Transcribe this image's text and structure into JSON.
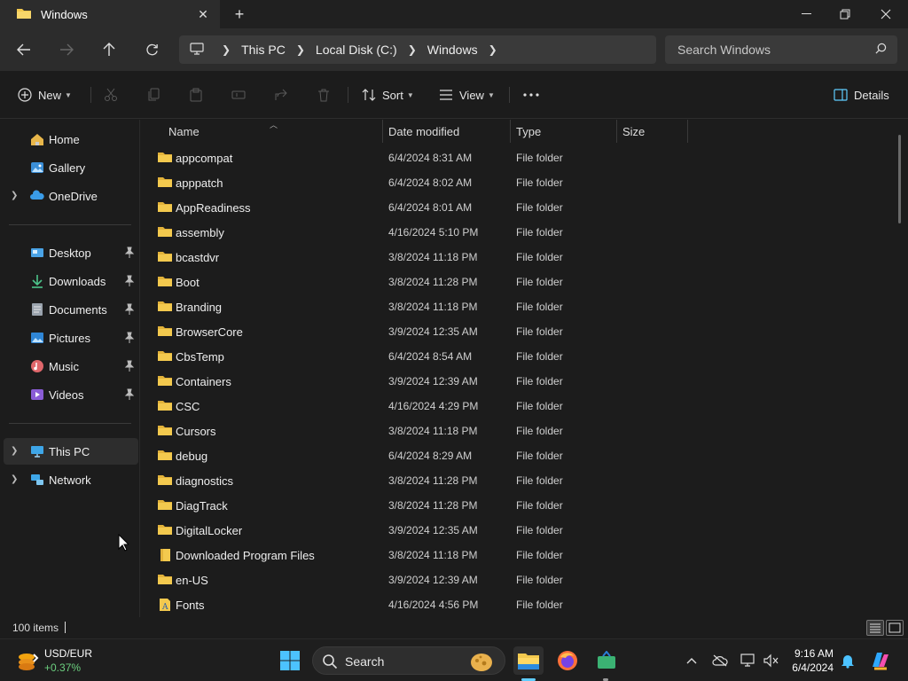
{
  "tab": {
    "title": "Windows"
  },
  "breadcrumb": [
    "This PC",
    "Local Disk (C:)",
    "Windows"
  ],
  "search": {
    "placeholder": "Search Windows"
  },
  "toolbar": {
    "new_label": "New",
    "sort_label": "Sort",
    "view_label": "View",
    "details_label": "Details"
  },
  "sidebar": {
    "top": [
      {
        "label": "Home",
        "icon": "home-icon"
      },
      {
        "label": "Gallery",
        "icon": "gallery-icon"
      },
      {
        "label": "OneDrive",
        "icon": "onedrive-icon"
      }
    ],
    "quick": [
      {
        "label": "Desktop",
        "icon": "desktop-icon"
      },
      {
        "label": "Downloads",
        "icon": "downloads-icon"
      },
      {
        "label": "Documents",
        "icon": "documents-icon"
      },
      {
        "label": "Pictures",
        "icon": "pictures-icon"
      },
      {
        "label": "Music",
        "icon": "music-icon"
      },
      {
        "label": "Videos",
        "icon": "videos-icon"
      }
    ],
    "bottom": [
      {
        "label": "This PC",
        "icon": "this-pc-icon"
      },
      {
        "label": "Network",
        "icon": "network-icon"
      }
    ]
  },
  "columns": {
    "name": "Name",
    "date": "Date modified",
    "type": "Type",
    "size": "Size"
  },
  "files": [
    {
      "name": "appcompat",
      "date": "6/4/2024 8:31 AM",
      "type": "File folder"
    },
    {
      "name": "apppatch",
      "date": "6/4/2024 8:02 AM",
      "type": "File folder"
    },
    {
      "name": "AppReadiness",
      "date": "6/4/2024 8:01 AM",
      "type": "File folder"
    },
    {
      "name": "assembly",
      "date": "4/16/2024 5:10 PM",
      "type": "File folder"
    },
    {
      "name": "bcastdvr",
      "date": "3/8/2024 11:18 PM",
      "type": "File folder"
    },
    {
      "name": "Boot",
      "date": "3/8/2024 11:28 PM",
      "type": "File folder"
    },
    {
      "name": "Branding",
      "date": "3/8/2024 11:18 PM",
      "type": "File folder"
    },
    {
      "name": "BrowserCore",
      "date": "3/9/2024 12:35 AM",
      "type": "File folder"
    },
    {
      "name": "CbsTemp",
      "date": "6/4/2024 8:54 AM",
      "type": "File folder"
    },
    {
      "name": "Containers",
      "date": "3/9/2024 12:39 AM",
      "type": "File folder"
    },
    {
      "name": "CSC",
      "date": "4/16/2024 4:29 PM",
      "type": "File folder"
    },
    {
      "name": "Cursors",
      "date": "3/8/2024 11:18 PM",
      "type": "File folder"
    },
    {
      "name": "debug",
      "date": "6/4/2024 8:29 AM",
      "type": "File folder"
    },
    {
      "name": "diagnostics",
      "date": "3/8/2024 11:28 PM",
      "type": "File folder"
    },
    {
      "name": "DiagTrack",
      "date": "3/8/2024 11:28 PM",
      "type": "File folder"
    },
    {
      "name": "DigitalLocker",
      "date": "3/9/2024 12:35 AM",
      "type": "File folder"
    },
    {
      "name": "Downloaded Program Files",
      "date": "3/8/2024 11:18 PM",
      "type": "File folder"
    },
    {
      "name": "en-US",
      "date": "3/9/2024 12:39 AM",
      "type": "File folder"
    },
    {
      "name": "Fonts",
      "date": "4/16/2024 4:56 PM",
      "type": "File folder"
    }
  ],
  "status": {
    "count": "100 items"
  },
  "taskbar": {
    "widget_title": "USD/EUR",
    "widget_value": "+0.37%",
    "search_label": "Search",
    "time": "9:16 AM",
    "date": "6/4/2024"
  },
  "colors": {
    "folder": "#f3c94e",
    "accent": "#60cdff"
  }
}
